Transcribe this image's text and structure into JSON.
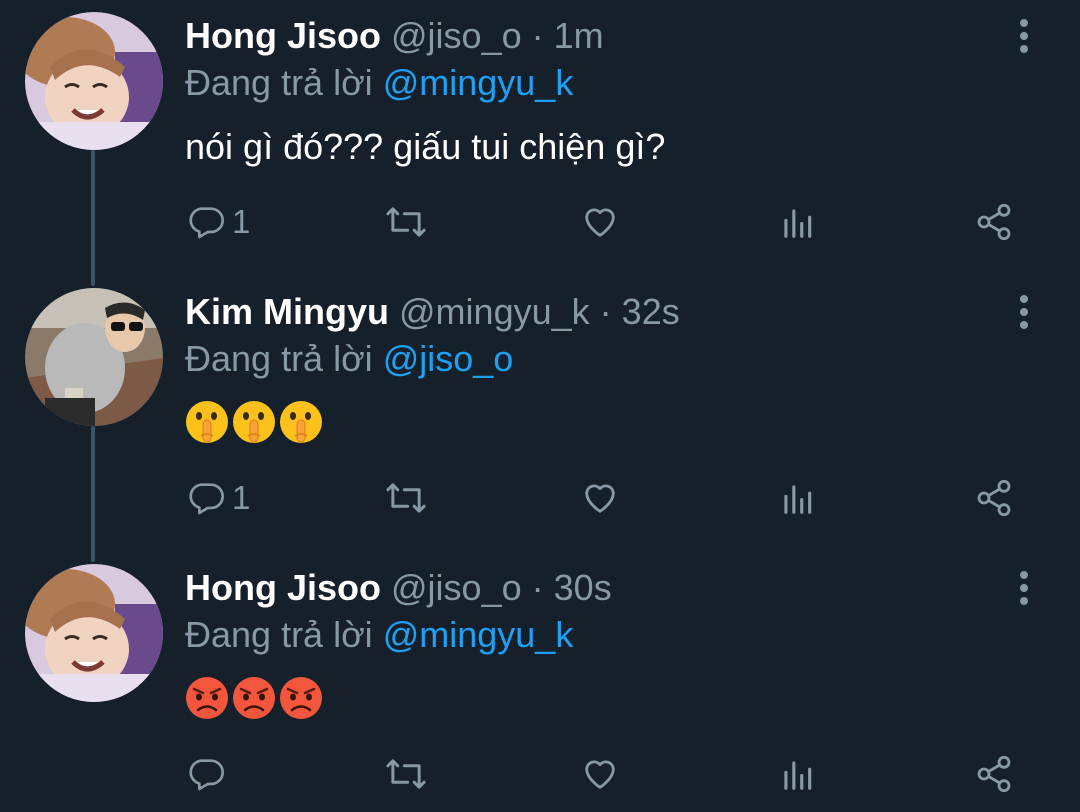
{
  "colors": {
    "background": "#15202b",
    "name": "#ffffff",
    "secondary": "#8899a6",
    "mention": "#1da1f2",
    "thread_line": "#3d5466"
  },
  "tweets": [
    {
      "display_name": "Hong Jisoo",
      "handle": "@jiso_o",
      "separator": "·",
      "time": "1m",
      "reply_prefix": "Đang trả lời",
      "reply_to": "@mingyu_k",
      "text": "nói gì đó??? giấu tui chiện gì?",
      "emojis": [],
      "reply_count": "1",
      "avatar": "avatar-hong-jisoo"
    },
    {
      "display_name": "Kim Mingyu",
      "handle": "@mingyu_k",
      "separator": "·",
      "time": "32s",
      "reply_prefix": "Đang trả lời",
      "reply_to": "@jiso_o",
      "text": "",
      "emojis": [
        "shushing-face-emoji",
        "shushing-face-emoji",
        "shushing-face-emoji"
      ],
      "reply_count": "1",
      "avatar": "avatar-kim-mingyu"
    },
    {
      "display_name": "Hong Jisoo",
      "handle": "@jiso_o",
      "separator": "·",
      "time": "30s",
      "reply_prefix": "Đang trả lời",
      "reply_to": "@mingyu_k",
      "text": "",
      "emojis": [
        "pouting-face-emoji",
        "pouting-face-emoji",
        "pouting-face-emoji"
      ],
      "reply_count": "",
      "avatar": "avatar-hong-jisoo"
    }
  ],
  "action_icons": [
    "reply-icon",
    "retweet-icon",
    "like-icon",
    "analytics-icon",
    "share-icon"
  ],
  "menu_icon": "more-options-icon"
}
